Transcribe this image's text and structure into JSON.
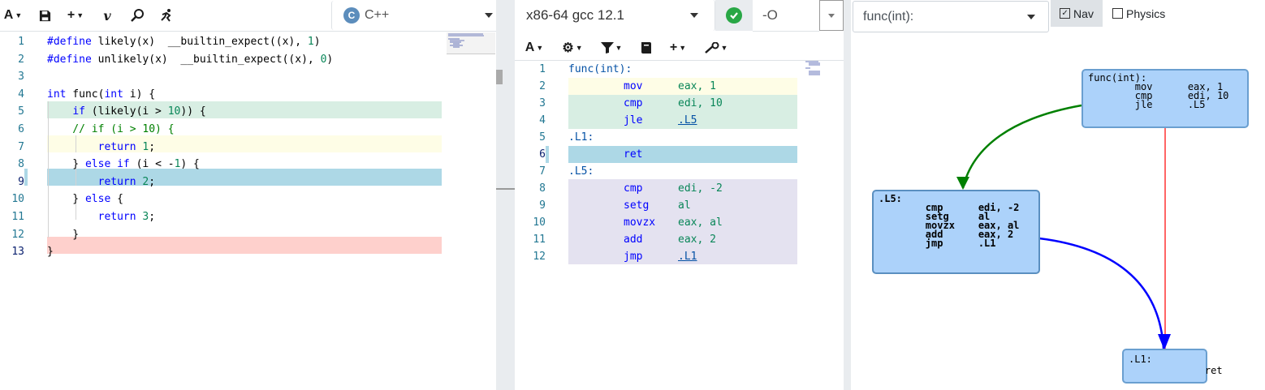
{
  "source": {
    "language": "C++",
    "lines": [
      {
        "n": "1",
        "text": "#define likely(x)  __builtin_expect((x), 1)"
      },
      {
        "n": "2",
        "text": "#define unlikely(x)  __builtin_expect((x), 0)"
      },
      {
        "n": "3",
        "text": ""
      },
      {
        "n": "4",
        "text": "int func(int i) {"
      },
      {
        "n": "5",
        "text": "    if (likely(i > 10)) {"
      },
      {
        "n": "6",
        "text": "    // if (i > 10) {"
      },
      {
        "n": "7",
        "text": "        return 1;"
      },
      {
        "n": "8",
        "text": "    } else if (i < -1) {"
      },
      {
        "n": "9",
        "text": "        return 2;"
      },
      {
        "n": "10",
        "text": "    } else {"
      },
      {
        "n": "11",
        "text": "        return 3;"
      },
      {
        "n": "12",
        "text": "    }"
      },
      {
        "n": "13",
        "text": "}"
      }
    ]
  },
  "compiler": {
    "name": "x86-64 gcc 12.1",
    "flags": "-O",
    "asm_lines": [
      {
        "n": "1",
        "label": "func(int):",
        "op": "",
        "args": ""
      },
      {
        "n": "2",
        "label": "",
        "op": "mov",
        "args": "eax, 1"
      },
      {
        "n": "3",
        "label": "",
        "op": "cmp",
        "args": "edi, 10"
      },
      {
        "n": "4",
        "label": "",
        "op": "jle",
        "args": ".L5"
      },
      {
        "n": "5",
        "label": ".L1:",
        "op": "",
        "args": ""
      },
      {
        "n": "6",
        "label": "",
        "op": "ret",
        "args": ""
      },
      {
        "n": "7",
        "label": ".L5:",
        "op": "",
        "args": ""
      },
      {
        "n": "8",
        "label": "",
        "op": "cmp",
        "args": "edi, -2"
      },
      {
        "n": "9",
        "label": "",
        "op": "setg",
        "args": "al"
      },
      {
        "n": "10",
        "label": "",
        "op": "movzx",
        "args": "eax, al"
      },
      {
        "n": "11",
        "label": "",
        "op": "add",
        "args": "eax, 2"
      },
      {
        "n": "12",
        "label": "",
        "op": "jmp",
        "args": ".L1"
      }
    ]
  },
  "cfg": {
    "function": "func(int):",
    "nav_label": "Nav",
    "physics_label": "Physics",
    "nav_checked": true,
    "physics_checked": false,
    "node_func": "func(int):\n        mov      eax, 1\n        cmp      edi, 10\n        jle      .L5",
    "node_l5": ".L5:\n        cmp      edi, -2\n        setg     al\n        movzx    eax, al\n        add      eax, 2\n        jmp      .L1",
    "node_l1": ".L1:\n             ret"
  },
  "colors": {
    "accent_green": "#28a745",
    "edge_true": "#008000",
    "edge_false": "#ff0000",
    "edge_jump": "#0000ff",
    "node_fill": "#acd2fa"
  }
}
